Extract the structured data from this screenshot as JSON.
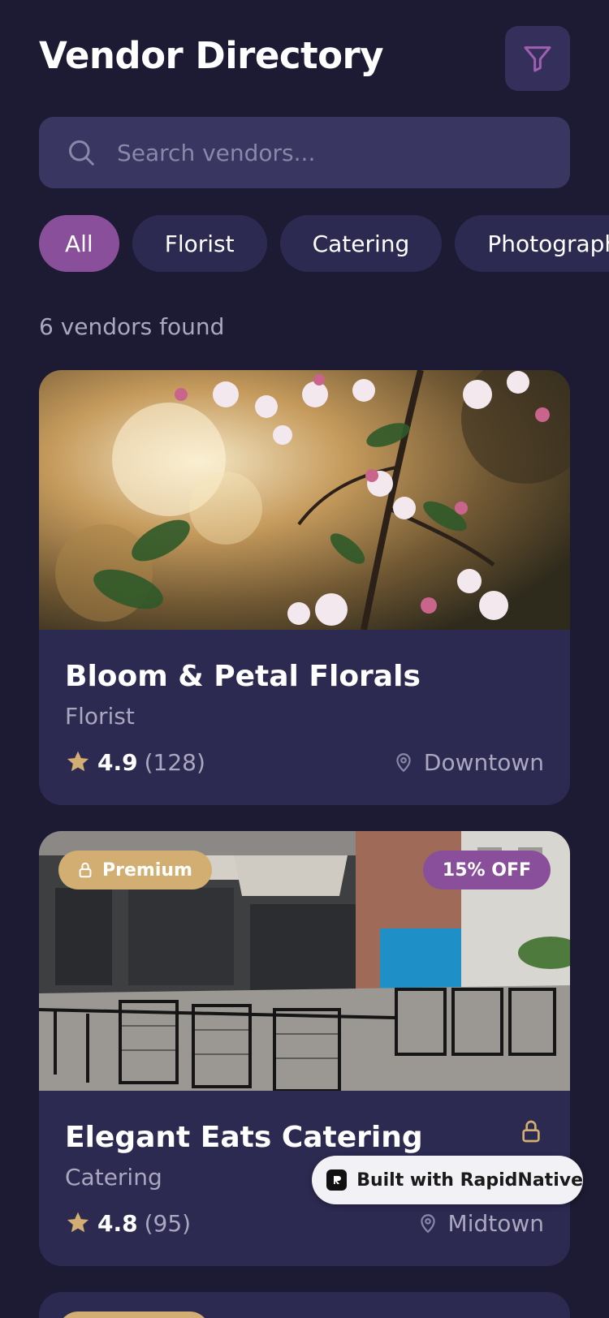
{
  "header": {
    "title": "Vendor Directory",
    "filter_icon": "filter-icon"
  },
  "search": {
    "placeholder": "Search vendors...",
    "value": "",
    "icon": "search-icon"
  },
  "filters": [
    {
      "label": "All",
      "active": true
    },
    {
      "label": "Florist",
      "active": false
    },
    {
      "label": "Catering",
      "active": false
    },
    {
      "label": "Photography",
      "active": false
    }
  ],
  "results": {
    "count_text": "6 vendors found"
  },
  "vendors": [
    {
      "name": "Bloom & Petal Florals",
      "category": "Florist",
      "rating": "4.9",
      "reviews": "(128)",
      "location": "Downtown",
      "image": "cherry blossom branch photo"
    },
    {
      "name": "Elegant Eats Catering",
      "category": "Catering",
      "rating": "4.8",
      "reviews": "(95)",
      "location": "Midtown",
      "premium_label": "Premium",
      "discount_label": "15% OFF",
      "image": "outdoor cafe terrace photo"
    }
  ],
  "badge": {
    "label": "Built with RapidNative"
  },
  "colors": {
    "background": "#1c1b33",
    "card": "#2d2a52",
    "accent_purple": "#8a4f9a",
    "gold": "#d2ae72",
    "muted_text": "#aaa7bf"
  }
}
